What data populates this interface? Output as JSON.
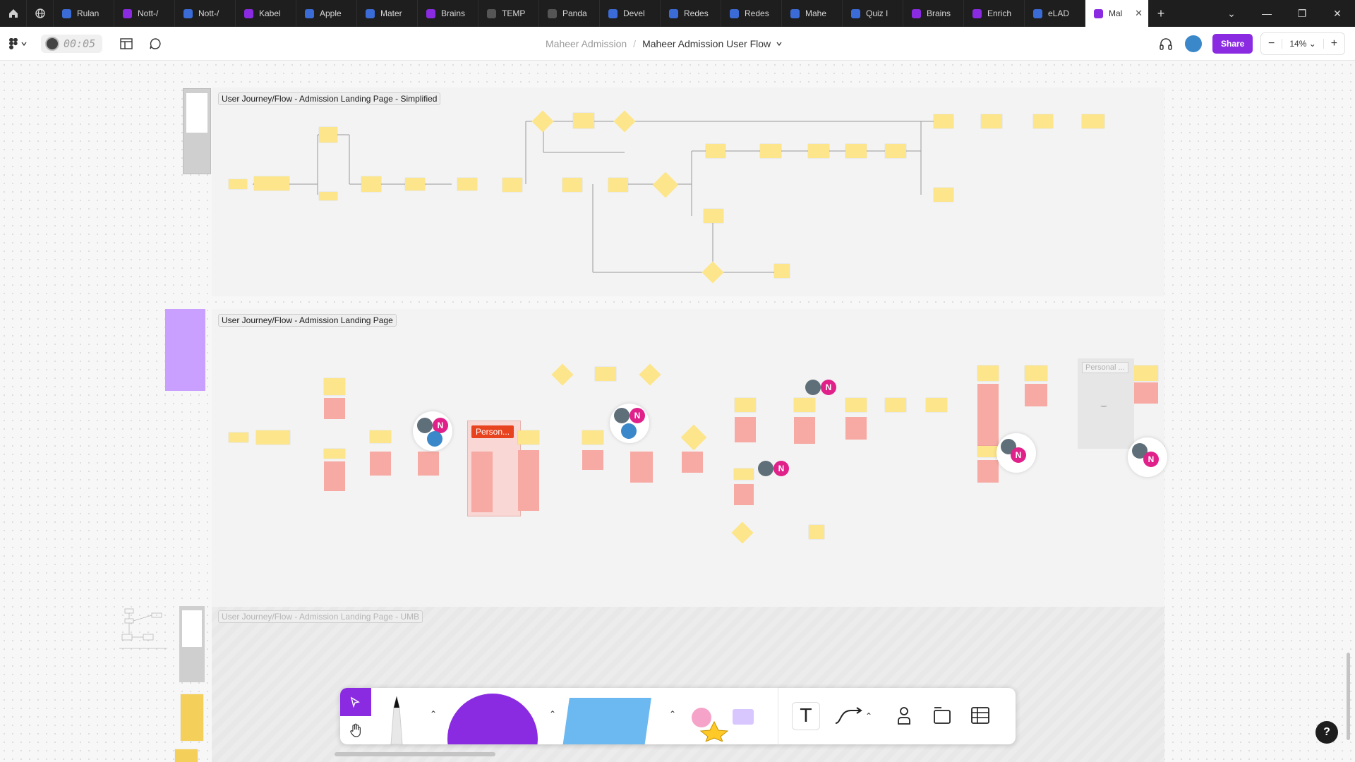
{
  "tabs": [
    {
      "label": "Rulan",
      "color": "#3b6bd6"
    },
    {
      "label": "Nott-/",
      "color": "#8a2be2"
    },
    {
      "label": "Nott-/",
      "color": "#3b6bd6"
    },
    {
      "label": "Kabel",
      "color": "#8a2be2"
    },
    {
      "label": "Apple",
      "color": "#3b6bd6"
    },
    {
      "label": "Mater",
      "color": "#3b6bd6"
    },
    {
      "label": "Brains",
      "color": "#8a2be2"
    },
    {
      "label": "TEMP",
      "color": "#555555"
    },
    {
      "label": "Panda",
      "color": "#555555"
    },
    {
      "label": "Devel",
      "color": "#3b6bd6"
    },
    {
      "label": "Redes",
      "color": "#3b6bd6"
    },
    {
      "label": "Redes",
      "color": "#3b6bd6"
    },
    {
      "label": "Mahe",
      "color": "#3b6bd6"
    },
    {
      "label": "Quiz I",
      "color": "#3b6bd6"
    },
    {
      "label": "Brains",
      "color": "#8a2be2"
    },
    {
      "label": "Enrich",
      "color": "#8a2be2"
    },
    {
      "label": "eLAD",
      "color": "#3b6bd6"
    }
  ],
  "active_tab": {
    "label": "Mal",
    "color": "#8a2be2"
  },
  "window_controls": {
    "chevron": "⌄",
    "minimize": "—",
    "restore": "❐",
    "close": "✕"
  },
  "toolbar": {
    "timer": "00:05",
    "breadcrumb_parent": "Maheer Admission",
    "breadcrumb_separator": "/",
    "board_title": "Maheer Admission User Flow",
    "share_label": "Share",
    "zoom_level": "14%"
  },
  "frames": {
    "simplified": "User Journey/Flow - Admission Landing Page - Simplified",
    "full": "User Journey/Flow - Admission Landing Page",
    "umb": "User Journey/Flow - Admission Landing Page - UMB"
  },
  "callouts": {
    "personal_red": "Person...",
    "personal_grey": "Personal ..."
  },
  "collaborator": {
    "initial": "N",
    "color": "#e0218a"
  },
  "help": "?",
  "icons": [
    "home-icon",
    "globe-icon",
    "figjam-menu-icon",
    "layout-icon",
    "comment-icon",
    "headphones-icon",
    "zoom-out-icon",
    "zoom-in-icon",
    "select-icon",
    "hand-icon",
    "pen-icon",
    "shape-icon",
    "sticky-icon",
    "stamp-icon",
    "text-icon",
    "connector-icon",
    "person-icon",
    "section-icon",
    "table-icon"
  ],
  "colors": {
    "brand": "#8a2be2",
    "sticky": "#fce58a",
    "sticky_pink": "#f7a9a3",
    "note_purple": "#c9a0ff",
    "alert_red": "#e8431f"
  }
}
